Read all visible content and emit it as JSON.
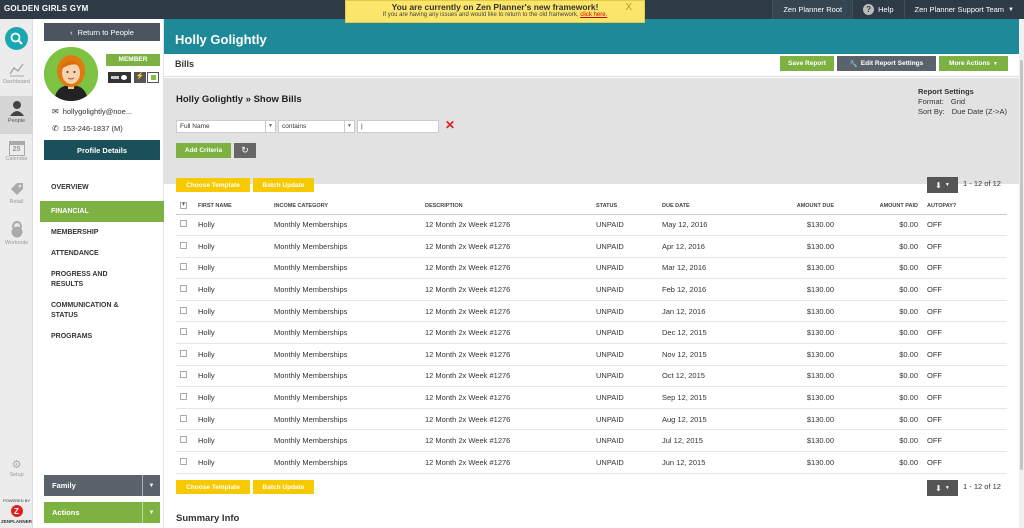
{
  "topbar": {
    "gym_name": "GOLDEN GIRLS GYM",
    "banner_title": "You are currently on Zen Planner's new framework!",
    "banner_sub": "If you are having any issues and would like to return to the old framework,",
    "banner_link": "click here.",
    "banner_close": "X",
    "root_label": "Zen Planner Root",
    "help_label": "Help",
    "support_label": "Zen Planner Support Team"
  },
  "iconnav": {
    "items": [
      {
        "label": "Dashboard",
        "icon": "chart-icon"
      },
      {
        "label": "People",
        "icon": "person-icon"
      },
      {
        "label": "Calendar",
        "icon": "calendar-icon",
        "day": "25"
      },
      {
        "label": "Retail",
        "icon": "tag-icon"
      },
      {
        "label": "Workouts",
        "icon": "kettlebell-icon"
      },
      {
        "label": "Setup",
        "icon": "gear-icon"
      }
    ],
    "powered_by": "POWERED BY",
    "zen_logo": "Z",
    "zen_brand": "ZENPLANNER"
  },
  "sidebar": {
    "return_label": "Return to People",
    "member_badge": "MEMBER",
    "email": "hollygolightly@noe...",
    "phone": "153-246-1837 (M)",
    "profile_details": "Profile Details",
    "menu": [
      {
        "label": "OVERVIEW"
      },
      {
        "label": "FINANCIAL"
      },
      {
        "label": "MEMBERSHIP"
      },
      {
        "label": "ATTENDANCE"
      },
      {
        "label": "PROGRESS AND RESULTS"
      },
      {
        "label": "COMMUNICATION & STATUS"
      },
      {
        "label": "PROGRAMS"
      }
    ],
    "family_label": "Family",
    "actions_label": "Actions"
  },
  "header": {
    "title": "Holly Golightly",
    "section": "Bills",
    "save_report": "Save Report",
    "edit_report": "Edit Report Settings",
    "more_actions": "More Actions"
  },
  "report": {
    "breadcrumb": "Holly Golightly » Show Bills",
    "settings_title": "Report Settings",
    "format_label": "Format:",
    "format_value": "Grid",
    "sort_label": "Sort By:",
    "sort_value": "Due Date (Z->A)",
    "criteria_field": "Full Name",
    "criteria_op": "contains",
    "criteria_value": "|",
    "add_criteria": "Add Criteria",
    "choose_template": "Choose Template",
    "batch_update": "Batch Update",
    "pagination": "1 - 12 of 12"
  },
  "table": {
    "headers": {
      "first_name": "FIRST NAME",
      "income_category": "INCOME CATEGORY",
      "description": "DESCRIPTION",
      "status": "STATUS",
      "due_date": "DUE DATE",
      "amount_due": "AMOUNT DUE",
      "amount_paid": "AMOUNT PAID",
      "autopay": "AUTOPAY?"
    },
    "rows": [
      {
        "first_name": "Holly",
        "income_category": "Monthly Memberships",
        "description": "12 Month 2x Week #1276",
        "status": "UNPAID",
        "due_date": "May 12, 2016",
        "amount_due": "$130.00",
        "amount_paid": "$0.00",
        "autopay": "OFF"
      },
      {
        "first_name": "Holly",
        "income_category": "Monthly Memberships",
        "description": "12 Month 2x Week #1276",
        "status": "UNPAID",
        "due_date": "Apr 12, 2016",
        "amount_due": "$130.00",
        "amount_paid": "$0.00",
        "autopay": "OFF"
      },
      {
        "first_name": "Holly",
        "income_category": "Monthly Memberships",
        "description": "12 Month 2x Week #1276",
        "status": "UNPAID",
        "due_date": "Mar 12, 2016",
        "amount_due": "$130.00",
        "amount_paid": "$0.00",
        "autopay": "OFF"
      },
      {
        "first_name": "Holly",
        "income_category": "Monthly Memberships",
        "description": "12 Month 2x Week #1276",
        "status": "UNPAID",
        "due_date": "Feb 12, 2016",
        "amount_due": "$130.00",
        "amount_paid": "$0.00",
        "autopay": "OFF"
      },
      {
        "first_name": "Holly",
        "income_category": "Monthly Memberships",
        "description": "12 Month 2x Week #1276",
        "status": "UNPAID",
        "due_date": "Jan 12, 2016",
        "amount_due": "$130.00",
        "amount_paid": "$0.00",
        "autopay": "OFF"
      },
      {
        "first_name": "Holly",
        "income_category": "Monthly Memberships",
        "description": "12 Month 2x Week #1276",
        "status": "UNPAID",
        "due_date": "Dec 12, 2015",
        "amount_due": "$130.00",
        "amount_paid": "$0.00",
        "autopay": "OFF"
      },
      {
        "first_name": "Holly",
        "income_category": "Monthly Memberships",
        "description": "12 Month 2x Week #1276",
        "status": "UNPAID",
        "due_date": "Nov 12, 2015",
        "amount_due": "$130.00",
        "amount_paid": "$0.00",
        "autopay": "OFF"
      },
      {
        "first_name": "Holly",
        "income_category": "Monthly Memberships",
        "description": "12 Month 2x Week #1276",
        "status": "UNPAID",
        "due_date": "Oct 12, 2015",
        "amount_due": "$130.00",
        "amount_paid": "$0.00",
        "autopay": "OFF"
      },
      {
        "first_name": "Holly",
        "income_category": "Monthly Memberships",
        "description": "12 Month 2x Week #1276",
        "status": "UNPAID",
        "due_date": "Sep 12, 2015",
        "amount_due": "$130.00",
        "amount_paid": "$0.00",
        "autopay": "OFF"
      },
      {
        "first_name": "Holly",
        "income_category": "Monthly Memberships",
        "description": "12 Month 2x Week #1276",
        "status": "UNPAID",
        "due_date": "Aug 12, 2015",
        "amount_due": "$130.00",
        "amount_paid": "$0.00",
        "autopay": "OFF"
      },
      {
        "first_name": "Holly",
        "income_category": "Monthly Memberships",
        "description": "12 Month 2x Week #1276",
        "status": "UNPAID",
        "due_date": "Jul 12, 2015",
        "amount_due": "$130.00",
        "amount_paid": "$0.00",
        "autopay": "OFF"
      },
      {
        "first_name": "Holly",
        "income_category": "Monthly Memberships",
        "description": "12 Month 2x Week #1276",
        "status": "UNPAID",
        "due_date": "Jun 12, 2015",
        "amount_due": "$130.00",
        "amount_paid": "$0.00",
        "autopay": "OFF"
      }
    ]
  },
  "summary_title": "Summary Info",
  "colors": {
    "teal": "#1e8a99",
    "green": "#7db243",
    "yellow": "#f7c900",
    "dark": "#2e3b46"
  }
}
